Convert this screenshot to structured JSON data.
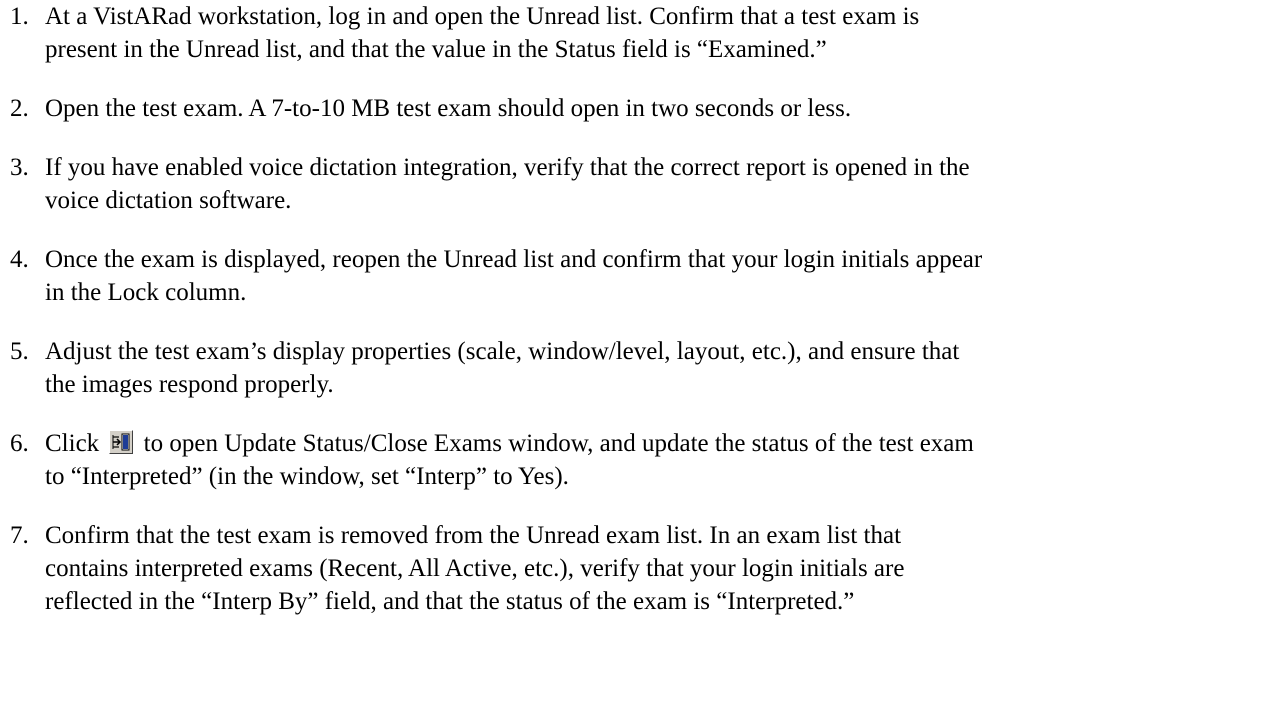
{
  "steps": [
    {
      "number": "1.",
      "lines": [
        "At a VistARad workstation, log in and open the Unread list. Confirm that a test exam is",
        "present in the Unread list, and that the value in the Status field is “Examined.”"
      ]
    },
    {
      "number": "2.",
      "lines": [
        "Open the test exam. A 7-to-10 MB test exam should open in two seconds or less."
      ]
    },
    {
      "number": "3.",
      "lines": [
        "If you have enabled voice dictation integration, verify that the correct report is opened in the",
        "voice dictation software."
      ]
    },
    {
      "number": "4.",
      "lines": [
        "Once the exam is displayed, reopen the Unread list and confirm that your login initials appear",
        "in the Lock column."
      ]
    },
    {
      "number": "5.",
      "lines": [
        "Adjust the test exam’s display properties (scale, window/level, layout, etc.), and ensure that",
        "the images respond properly."
      ]
    },
    {
      "number": "6.",
      "line1_before_icon": "Click",
      "line1_after_icon": "to open Update Status/Close Exams window, and update the status of the test exam",
      "icon": "update-status-close-exams-icon",
      "lines_rest": [
        "to “Interpreted” (in the window, set “Interp” to Yes)."
      ]
    },
    {
      "number": "7.",
      "lines": [
        "Confirm that the test exam is removed from the Unread exam list. In an exam list that",
        "contains interpreted exams (Recent, All Active, etc.), verify that your login initials are",
        "reflected in the “Interp By” field, and that the status of the exam is “Interpreted.”"
      ]
    }
  ]
}
